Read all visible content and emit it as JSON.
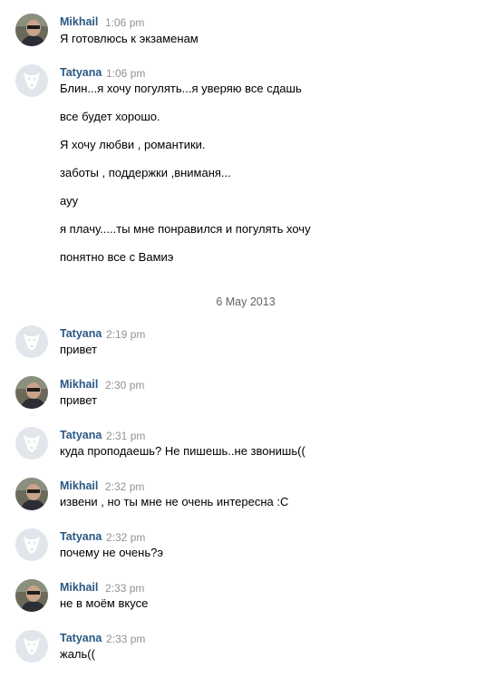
{
  "date_separator": "6 May 2013",
  "messages": [
    {
      "author": "Mikhail",
      "time": "1:06 pm",
      "avatar": "mikhail-photo",
      "lines": [
        "Я готовлюсь к экзаменам"
      ]
    },
    {
      "author": "Tatyana",
      "time": "1:06 pm",
      "avatar": "dog-placeholder",
      "lines": [
        "Блин...я хочу погулять...я уверяю все сдашь",
        "все будет хорошо.",
        "Я хочу любви , романтики.",
        "заботы , поддержки ,вниманя...",
        "ауу",
        "я плачу.....ты мне понравился и погулять хочу",
        "понятно все с Вамиэ"
      ]
    },
    {
      "author": "Tatyana",
      "time": "2:19 pm",
      "avatar": "dog-placeholder",
      "lines": [
        "привет"
      ]
    },
    {
      "author": "Mikhail",
      "time": "2:30 pm",
      "avatar": "mikhail-photo",
      "lines": [
        "привет"
      ]
    },
    {
      "author": "Tatyana",
      "time": "2:31 pm",
      "avatar": "dog-placeholder",
      "lines": [
        "куда проподаешь? Не пишешь..не звонишь(("
      ]
    },
    {
      "author": "Mikhail",
      "time": "2:32 pm",
      "avatar": "mikhail-photo",
      "lines": [
        "извени , но ты мне не очень интересна :С"
      ]
    },
    {
      "author": "Tatyana",
      "time": "2:32 pm",
      "avatar": "dog-placeholder",
      "lines": [
        "почему не очень?э"
      ]
    },
    {
      "author": "Mikhail",
      "time": "2:33 pm",
      "avatar": "mikhail-photo",
      "lines": [
        "не в моём вкусе"
      ]
    },
    {
      "author": "Tatyana",
      "time": "2:33 pm",
      "avatar": "dog-placeholder",
      "lines": [
        "жаль(("
      ]
    }
  ]
}
